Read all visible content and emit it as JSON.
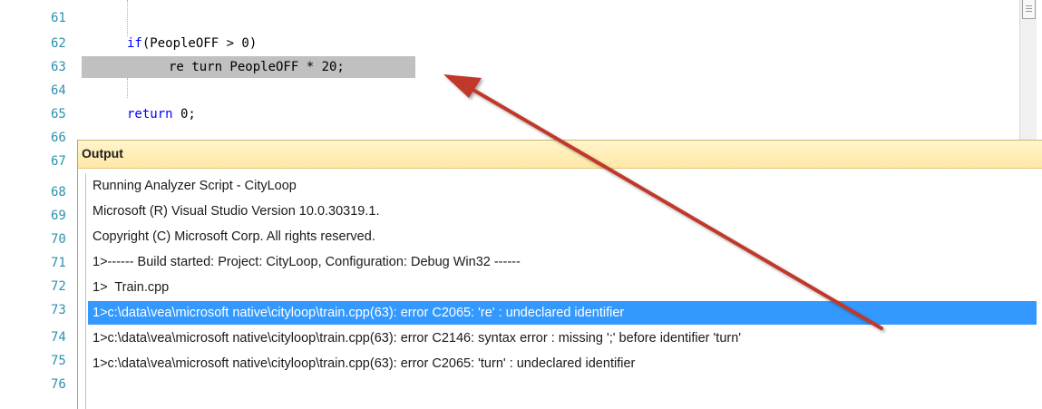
{
  "editor": {
    "line_numbers": [
      "61",
      "62",
      "63",
      "64",
      "65",
      "66",
      "67",
      "68",
      "69",
      "70",
      "71",
      "72",
      "73",
      "74",
      "75",
      "76"
    ],
    "code": {
      "line_62_keyword": "if",
      "line_62_rest": "(PeopleOFF > 0)",
      "line_63": "re turn PeopleOFF * 20;",
      "line_65_keyword": "return",
      "line_65_rest": " 0;"
    }
  },
  "output": {
    "title": "Output",
    "lines": [
      "Running Analyzer Script - CityLoop",
      "Microsoft (R) Visual Studio Version 10.0.30319.1.",
      "Copyright (C) Microsoft Corp. All rights reserved.",
      "1>------ Build started: Project: CityLoop, Configuration: Debug Win32 ------",
      "1>  Train.cpp",
      "1>c:\\data\\vea\\microsoft native\\cityloop\\train.cpp(63): error C2065: 're' : undeclared identifier",
      "1>c:\\data\\vea\\microsoft native\\cityloop\\train.cpp(63): error C2146: syntax error : missing ';' before identifier 'turn'",
      "1>c:\\data\\vea\\microsoft native\\cityloop\\train.cpp(63): error C2065: 'turn' : undeclared identifier"
    ],
    "selected_index": 5
  },
  "annotation": {
    "arrow_color": "#c0392b"
  },
  "colors": {
    "line_number": "#2b91af",
    "keyword": "#0000ff",
    "selection": "#3399ff",
    "highlight": "#c0c0c0",
    "header": "#ffefb3"
  }
}
